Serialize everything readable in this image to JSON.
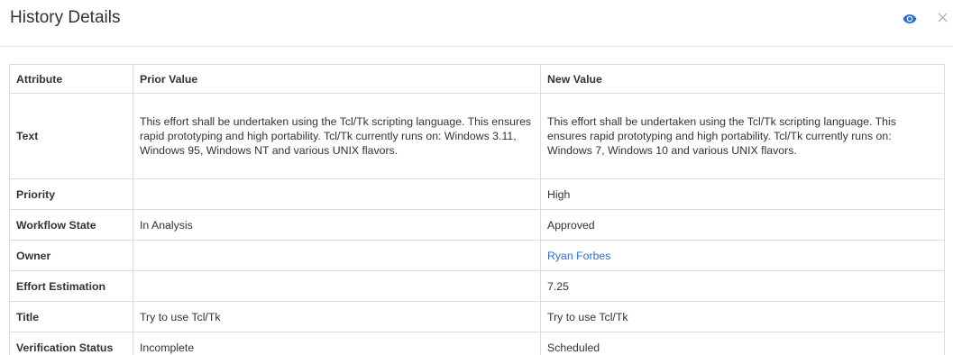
{
  "header": {
    "title": "History Details",
    "eye_icon": "eye-icon",
    "close_icon": "close-icon",
    "close_glyph": "×"
  },
  "table": {
    "columns": [
      "Attribute",
      "Prior Value",
      "New Value"
    ],
    "rows": [
      {
        "attribute": "Text",
        "prior": "This effort shall be undertaken using the Tcl/Tk scripting language. This ensures rapid prototyping and high portability. Tcl/Tk currently runs on: Windows 3.11, Windows 95, Windows NT and various UNIX flavors.",
        "new": "This effort shall be undertaken using the Tcl/Tk scripting language. This ensures rapid prototyping and high portability. Tcl/Tk currently runs on: Windows 7, Windows 10 and various UNIX flavors."
      },
      {
        "attribute": "Priority",
        "prior": "",
        "new": "High"
      },
      {
        "attribute": "Workflow State",
        "prior": "In Analysis",
        "new": "Approved"
      },
      {
        "attribute": "Owner",
        "prior": "",
        "new": "Ryan Forbes"
      },
      {
        "attribute": "Effort Estimation",
        "prior": "",
        "new": "7.25"
      },
      {
        "attribute": "Title",
        "prior": "Try to use Tcl/Tk",
        "new": "Try to use Tcl/Tk"
      },
      {
        "attribute": "Verification Status",
        "prior": "Incomplete",
        "new": "Scheduled"
      }
    ]
  },
  "colors": {
    "link": "#2a6fd6",
    "eye_icon": "#2a6fd6",
    "border": "#dddddd"
  }
}
